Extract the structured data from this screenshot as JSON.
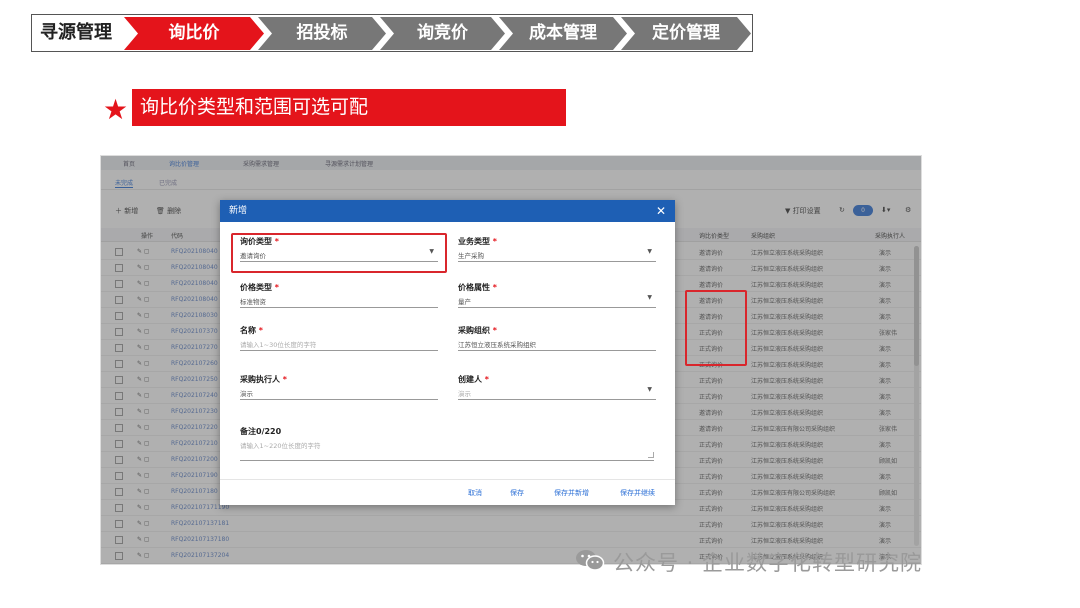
{
  "banner": {
    "title": "寻源管理",
    "steps": [
      {
        "label": "询比价",
        "active": true
      },
      {
        "label": "招投标",
        "active": false
      },
      {
        "label": "询竞价",
        "active": false
      },
      {
        "label": "成本管理",
        "active": false
      },
      {
        "label": "定价管理",
        "active": false
      }
    ]
  },
  "headline": {
    "star_icon": "star-icon",
    "text": "询比价类型和范围可选可配"
  },
  "app": {
    "tabs": [
      "首页",
      "询比价管理",
      "采购需求管理",
      "寻源需求计划管理"
    ],
    "subtabs": [
      "未完成",
      "已完成"
    ],
    "toolbar": {
      "add": "新增",
      "delete": "删除",
      "print": "打印设置",
      "toggle": "0"
    },
    "grid_headers": [
      "操作",
      "代码",
      "询比价类型",
      "采购组织",
      "采购执行人"
    ],
    "rows": [
      {
        "code": "RFQ202108040",
        "type": "邀请询价",
        "org": "江苏恒立液压系统采购组织",
        "person": "演示"
      },
      {
        "code": "RFQ202108040",
        "type": "邀请询价",
        "org": "江苏恒立液压系统采购组织",
        "person": "演示"
      },
      {
        "code": "RFQ202108040",
        "type": "邀请询价",
        "org": "江苏恒立液压系统采购组织",
        "person": "演示"
      },
      {
        "code": "RFQ202108040",
        "type": "邀请询价",
        "org": "江苏恒立液压系统采购组织",
        "person": "演示"
      },
      {
        "code": "RFQ202108030",
        "type": "邀请询价",
        "org": "江苏恒立液压系统采购组织",
        "person": "演示"
      },
      {
        "code": "RFQ202107370",
        "type": "正式询价",
        "org": "江苏恒立液压系统采购组织",
        "person": "张家伟"
      },
      {
        "code": "RFQ202107270",
        "type": "正式询价",
        "org": "江苏恒立液压系统采购组织",
        "person": "演示"
      },
      {
        "code": "RFQ202107260",
        "type": "正式询价",
        "org": "江苏恒立液压系统采购组织",
        "person": "演示"
      },
      {
        "code": "RFQ202107250",
        "type": "正式询价",
        "org": "江苏恒立液压系统采购组织",
        "person": "演示"
      },
      {
        "code": "RFQ202107240",
        "type": "正式询价",
        "org": "江苏恒立液压系统采购组织",
        "person": "演示"
      },
      {
        "code": "RFQ202107230",
        "type": "邀请询价",
        "org": "江苏恒立液压系统采购组织",
        "person": "演示"
      },
      {
        "code": "RFQ202107220",
        "type": "邀请询价",
        "org": "江苏恒立液压有限公司采购组织",
        "person": "张家伟"
      },
      {
        "code": "RFQ202107210",
        "type": "正式询价",
        "org": "江苏恒立液压系统采购组织",
        "person": "演示"
      },
      {
        "code": "RFQ202107200",
        "type": "正式询价",
        "org": "江苏恒立液压系统采购组织",
        "person": "顾凯如"
      },
      {
        "code": "RFQ202107190",
        "type": "正式询价",
        "org": "江苏恒立液压系统采购组织",
        "person": "演示"
      },
      {
        "code": "RFQ202107180",
        "type": "正式询价",
        "org": "江苏恒立液压有限公司采购组织",
        "person": "顾凯如"
      },
      {
        "code": "RFQ202107171190",
        "type": "正式询价",
        "org": "江苏恒立液压系统采购组织",
        "person": "演示"
      },
      {
        "code": "RFQ202107137181",
        "type": "正式询价",
        "org": "江苏恒立液压系统采购组织",
        "person": "演示"
      },
      {
        "code": "RFQ202107137180",
        "type": "正式询价",
        "org": "江苏恒立液压系统采购组织",
        "person": "演示"
      },
      {
        "code": "RFQ202107137204",
        "type": "正式询价",
        "org": "江苏恒立液压系统采购组织",
        "person": "演示"
      }
    ]
  },
  "modal": {
    "title": "新增",
    "fields": {
      "inquiry_type": {
        "label": "询价类型",
        "value": "邀请询价"
      },
      "business_type": {
        "label": "业务类型",
        "value": "生产采购"
      },
      "price_type": {
        "label": "价格类型",
        "value": "标准物资"
      },
      "price_attr": {
        "label": "价格属性",
        "value": "量产"
      },
      "name": {
        "label": "名称",
        "placeholder": "请输入1~30位长度的字符"
      },
      "purchase_org": {
        "label": "采购组织",
        "value": "江苏恒立液压系统采购组织"
      },
      "executor": {
        "label": "采购执行人",
        "value": "演示"
      },
      "creator": {
        "label": "创建人",
        "value": "演示"
      },
      "remark": {
        "label": "备注0/220",
        "placeholder": "请输入1~220位长度的字符"
      }
    },
    "required_mark": "*",
    "buttons": {
      "cancel": "取消",
      "save": "保存",
      "save_new": "保存并新增",
      "save_continue": "保存并继续"
    }
  },
  "watermark": {
    "text": "公众号 · 企业数字化转型研究院",
    "icon": "wechat-icon"
  },
  "colors": {
    "accent_red": "#e4141b",
    "modal_header": "#1e5fb4",
    "inactive_step": "#777777",
    "highlight_frame": "#d9262c"
  }
}
